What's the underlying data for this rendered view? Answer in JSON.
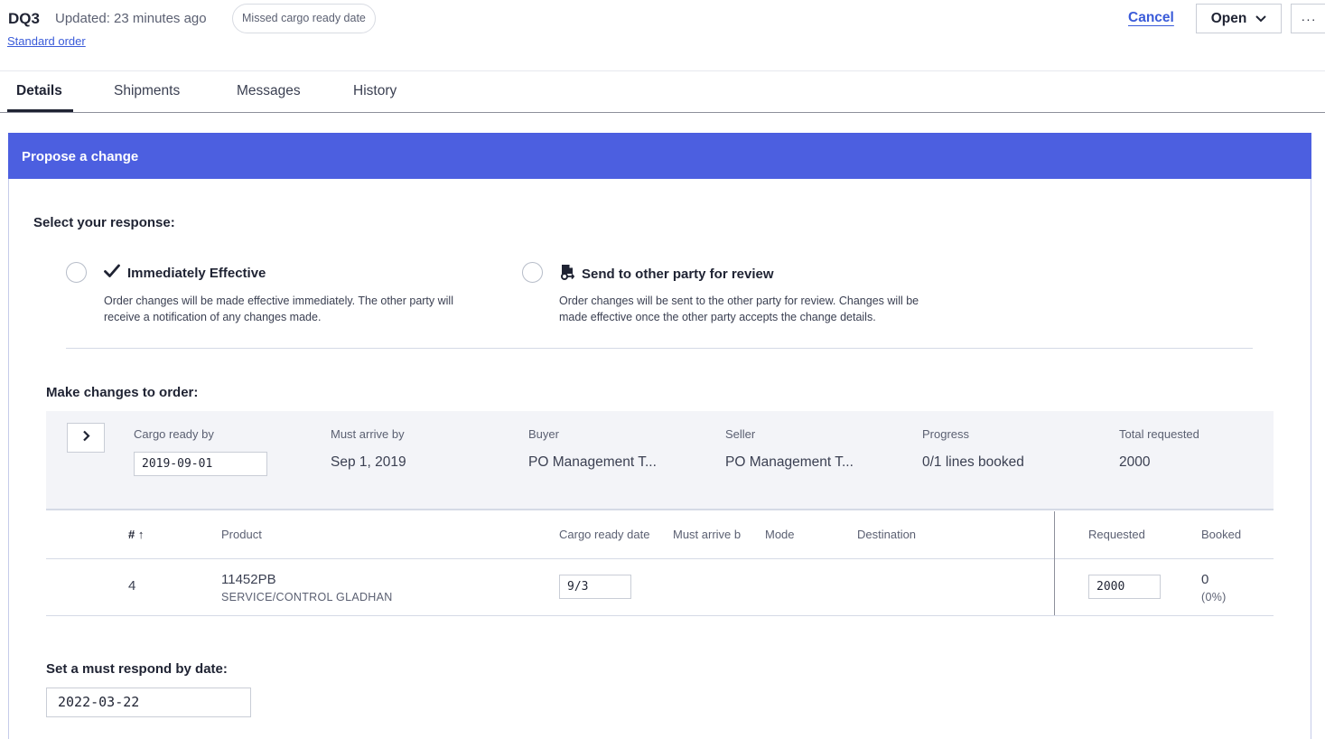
{
  "header": {
    "order_id": "DQ3",
    "updated": "Updated: 23 minutes ago",
    "status_badge": "Missed cargo ready date",
    "order_type": "Standard order",
    "cancel_label": "Cancel",
    "status_dropdown": "Open",
    "more_label": "···"
  },
  "tabs": [
    {
      "label": "Details",
      "active": true
    },
    {
      "label": "Shipments",
      "active": false
    },
    {
      "label": "Messages",
      "active": false
    },
    {
      "label": "History",
      "active": false
    }
  ],
  "panel": {
    "title": "Propose a change",
    "response_label": "Select your response:",
    "options": [
      {
        "icon": "check-icon",
        "title": "Immediately Effective",
        "description_line1": "Order changes will be made effective immediately. The other party will",
        "description_line2": "receive a notification of any changes made.",
        "selected": false
      },
      {
        "icon": "document-review-icon",
        "title": "Send to other party for review",
        "description_line1": "Order changes will be sent to the other party for review. Changes will be",
        "description_line2": "made effective once the other party accepts the change details.",
        "selected": false
      }
    ],
    "changes_label": "Make changes to order:",
    "summary": {
      "cargo_ready_label": "Cargo ready by",
      "cargo_ready_value": "2019-09-01",
      "must_arrive_label": "Must arrive by",
      "must_arrive_value": "Sep 1, 2019",
      "buyer_label": "Buyer",
      "buyer_value": "PO Management T...",
      "seller_label": "Seller",
      "seller_value": "PO Management T...",
      "progress_label": "Progress",
      "progress_value": "0/1 lines booked",
      "total_label": "Total requested",
      "total_value": "2000"
    },
    "table": {
      "headers": {
        "num": "# ↑",
        "product": "Product",
        "cargo_ready": "Cargo ready date",
        "must_arrive": "Must arrive b",
        "mode": "Mode",
        "destination": "Destination",
        "requested": "Requested",
        "booked": "Booked"
      },
      "rows": [
        {
          "num": "4",
          "product_code": "11452PB",
          "product_desc": "SERVICE/CONTROL GLADHAN",
          "cargo_ready": "9/3",
          "requested": "2000",
          "booked": "0",
          "booked_pct": "(0%)"
        }
      ]
    },
    "respond_label": "Set a must respond by date:",
    "respond_value": "2022-03-22"
  },
  "colors": {
    "accent": "#4c5fe0",
    "link": "#3a5bd9"
  }
}
